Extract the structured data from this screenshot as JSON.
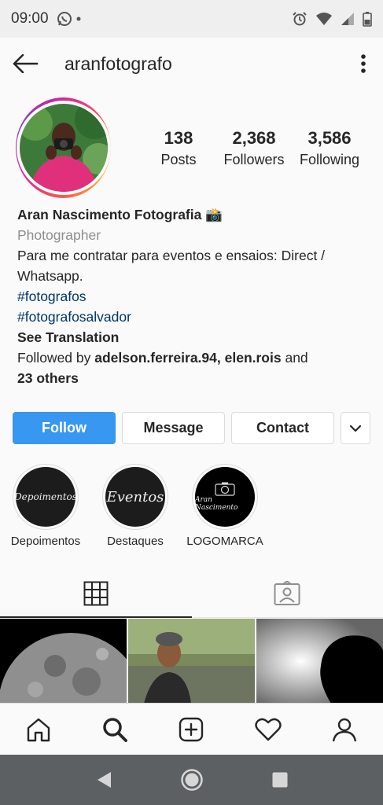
{
  "status_bar": {
    "time": "09:00",
    "left_icons": [
      "whatsapp-icon",
      "dot-icon"
    ],
    "right_icons": [
      "alarm-icon",
      "wifi-icon",
      "signal-icon",
      "battery-icon"
    ]
  },
  "header": {
    "username": "aranfotografo",
    "back_icon": "arrow-left-icon",
    "more_icon": "more-vertical-icon"
  },
  "profile": {
    "stats": [
      {
        "value": "138",
        "label": "Posts"
      },
      {
        "value": "2,368",
        "label": "Followers"
      },
      {
        "value": "3,586",
        "label": "Following"
      }
    ]
  },
  "bio": {
    "name": "Aran Nascimento Fotografia 📸",
    "category": "Photographer",
    "text": "Para me contratar para eventos e ensaios: Direct / Whatsapp.",
    "hashtag1": "#fotografos",
    "hashtag2": "#fotografosalvador",
    "see_translation": "See Translation",
    "followed_prefix": "Followed by ",
    "followed_users": "adelson.ferreira.94, elen.rois",
    "followed_and": " and",
    "followed_others": "23 others"
  },
  "actions": {
    "follow": "Follow",
    "message": "Message",
    "contact": "Contact"
  },
  "highlights": [
    {
      "label": "Depoimentos",
      "cover_text": "Depoimentos"
    },
    {
      "label": "Destaques",
      "cover_text": "Eventos"
    },
    {
      "label": "LOGOMARCA",
      "cover_text": "Aran Nascimento"
    }
  ],
  "tabs": [
    "grid-icon",
    "tagged-icon"
  ],
  "bottom_nav": [
    "home-icon",
    "search-icon",
    "add-icon",
    "heart-icon",
    "profile-icon"
  ],
  "colors": {
    "follow_button": "#3897f0",
    "hashtag": "#003569",
    "secondary_text": "#8e8e8e"
  }
}
